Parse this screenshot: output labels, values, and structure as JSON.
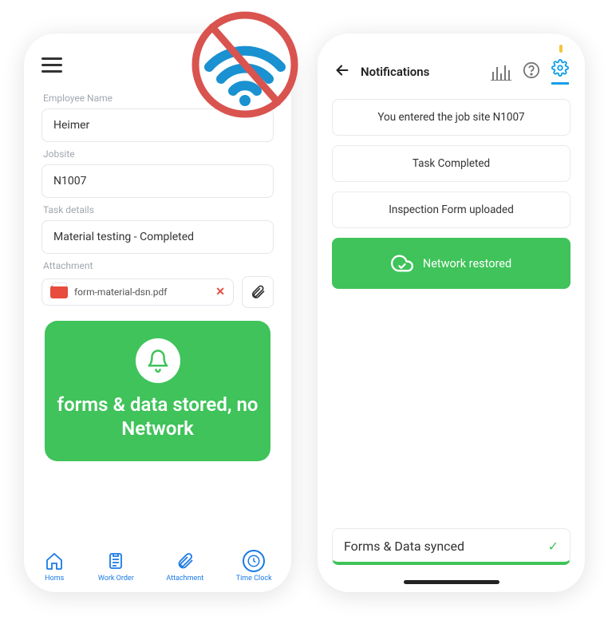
{
  "left": {
    "labels": {
      "employee": "Employee Name",
      "jobsite": "Jobsite",
      "task": "Task details",
      "attachment": "Attachment"
    },
    "values": {
      "employee": "Heimer",
      "jobsite": "N1007",
      "task": "Material testing - Completed",
      "file": "form-material-dsn.pdf"
    },
    "banner": "forms & data stored, no Network",
    "nav": [
      "Homs",
      "Work Order",
      "Attachment",
      "Time Clock"
    ]
  },
  "right": {
    "title": "Notifications",
    "items": [
      "You entered the job site N1007",
      "Task Completed",
      "Inspection Form uploaded"
    ],
    "network": "Network restored",
    "sync": "Forms & Data synced"
  }
}
